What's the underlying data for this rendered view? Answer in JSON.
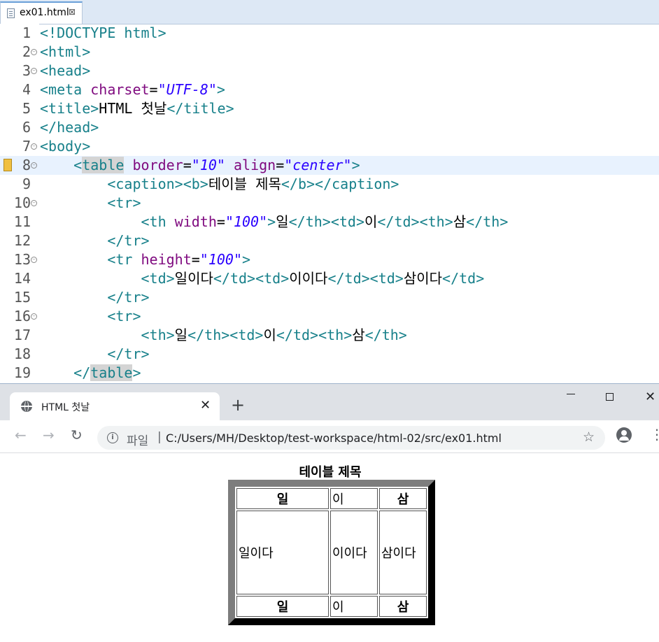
{
  "editor": {
    "tab_label": "ex01.html",
    "close_glyph": "⊠",
    "lines": [
      {
        "n": "1",
        "fold": false,
        "current": false,
        "tokens": [
          {
            "c": "t",
            "s": "<!DOCTYPE html>"
          }
        ]
      },
      {
        "n": "2",
        "fold": true,
        "current": false,
        "tokens": [
          {
            "c": "t",
            "s": "<html>"
          }
        ]
      },
      {
        "n": "3",
        "fold": true,
        "current": false,
        "tokens": [
          {
            "c": "t",
            "s": "<head>"
          }
        ]
      },
      {
        "n": "4",
        "fold": false,
        "current": false,
        "tokens": [
          {
            "c": "t",
            "s": "<meta "
          },
          {
            "c": "a",
            "s": "charset"
          },
          {
            "c": "x",
            "s": "="
          },
          {
            "c": "v",
            "s": "\"UTF-8\""
          },
          {
            "c": "t",
            "s": ">"
          }
        ]
      },
      {
        "n": "5",
        "fold": false,
        "current": false,
        "tokens": [
          {
            "c": "t",
            "s": "<title>"
          },
          {
            "c": "x",
            "s": "HTML 첫날"
          },
          {
            "c": "t",
            "s": "</title>"
          }
        ]
      },
      {
        "n": "6",
        "fold": false,
        "current": false,
        "tokens": [
          {
            "c": "t",
            "s": "</head>"
          }
        ]
      },
      {
        "n": "7",
        "fold": true,
        "current": false,
        "tokens": [
          {
            "c": "t",
            "s": "<body>"
          }
        ]
      },
      {
        "n": "8",
        "fold": true,
        "current": true,
        "marker": true,
        "tokens": [
          {
            "c": "x",
            "s": "    "
          },
          {
            "c": "t",
            "s": "<"
          },
          {
            "c": "t hl",
            "s": "table"
          },
          {
            "c": "t",
            "s": " "
          },
          {
            "c": "a",
            "s": "border"
          },
          {
            "c": "x",
            "s": "="
          },
          {
            "c": "v",
            "s": "\"10\""
          },
          {
            "c": "x",
            "s": " "
          },
          {
            "c": "a",
            "s": "align"
          },
          {
            "c": "x",
            "s": "="
          },
          {
            "c": "v",
            "s": "\"center\""
          },
          {
            "c": "t",
            "s": ">"
          }
        ]
      },
      {
        "n": "9",
        "fold": false,
        "current": false,
        "tokens": [
          {
            "c": "x",
            "s": "        "
          },
          {
            "c": "t",
            "s": "<caption><b>"
          },
          {
            "c": "x",
            "s": "테이블 제목"
          },
          {
            "c": "t",
            "s": "</b></caption>"
          }
        ]
      },
      {
        "n": "10",
        "fold": true,
        "current": false,
        "tokens": [
          {
            "c": "x",
            "s": "        "
          },
          {
            "c": "t",
            "s": "<tr>"
          }
        ]
      },
      {
        "n": "11",
        "fold": false,
        "current": false,
        "tokens": [
          {
            "c": "x",
            "s": "            "
          },
          {
            "c": "t",
            "s": "<th "
          },
          {
            "c": "a",
            "s": "width"
          },
          {
            "c": "x",
            "s": "="
          },
          {
            "c": "v",
            "s": "\"100\""
          },
          {
            "c": "t",
            "s": ">"
          },
          {
            "c": "x",
            "s": "일"
          },
          {
            "c": "t",
            "s": "</th><td>"
          },
          {
            "c": "x",
            "s": "이"
          },
          {
            "c": "t",
            "s": "</td><th>"
          },
          {
            "c": "x",
            "s": "삼"
          },
          {
            "c": "t",
            "s": "</th>"
          }
        ]
      },
      {
        "n": "12",
        "fold": false,
        "current": false,
        "tokens": [
          {
            "c": "x",
            "s": "        "
          },
          {
            "c": "t",
            "s": "</tr>"
          }
        ]
      },
      {
        "n": "13",
        "fold": true,
        "current": false,
        "tokens": [
          {
            "c": "x",
            "s": "        "
          },
          {
            "c": "t",
            "s": "<tr "
          },
          {
            "c": "a",
            "s": "height"
          },
          {
            "c": "x",
            "s": "="
          },
          {
            "c": "v",
            "s": "\"100\""
          },
          {
            "c": "t",
            "s": ">"
          }
        ]
      },
      {
        "n": "14",
        "fold": false,
        "current": false,
        "tokens": [
          {
            "c": "x",
            "s": "            "
          },
          {
            "c": "t",
            "s": "<td>"
          },
          {
            "c": "x",
            "s": "일이다"
          },
          {
            "c": "t",
            "s": "</td><td>"
          },
          {
            "c": "x",
            "s": "이이다"
          },
          {
            "c": "t",
            "s": "</td><td>"
          },
          {
            "c": "x",
            "s": "삼이다"
          },
          {
            "c": "t",
            "s": "</td>"
          }
        ]
      },
      {
        "n": "15",
        "fold": false,
        "current": false,
        "tokens": [
          {
            "c": "x",
            "s": "        "
          },
          {
            "c": "t",
            "s": "</tr>"
          }
        ]
      },
      {
        "n": "16",
        "fold": true,
        "current": false,
        "tokens": [
          {
            "c": "x",
            "s": "        "
          },
          {
            "c": "t",
            "s": "<tr>"
          }
        ]
      },
      {
        "n": "17",
        "fold": false,
        "current": false,
        "tokens": [
          {
            "c": "x",
            "s": "            "
          },
          {
            "c": "t",
            "s": "<th>"
          },
          {
            "c": "x",
            "s": "일"
          },
          {
            "c": "t",
            "s": "</th><td>"
          },
          {
            "c": "x",
            "s": "이"
          },
          {
            "c": "t",
            "s": "</td><th>"
          },
          {
            "c": "x",
            "s": "삼"
          },
          {
            "c": "t",
            "s": "</th>"
          }
        ]
      },
      {
        "n": "18",
        "fold": false,
        "current": false,
        "tokens": [
          {
            "c": "x",
            "s": "        "
          },
          {
            "c": "t",
            "s": "</tr>"
          }
        ]
      },
      {
        "n": "19",
        "fold": false,
        "current": false,
        "tokens": [
          {
            "c": "x",
            "s": "    "
          },
          {
            "c": "t",
            "s": "</"
          },
          {
            "c": "t hl",
            "s": "table"
          },
          {
            "c": "t",
            "s": ">"
          }
        ]
      }
    ]
  },
  "browser": {
    "tab_title": "HTML 첫날",
    "tab_close": "✕",
    "new_tab": "+",
    "window_close": "✕",
    "back": "←",
    "forward": "→",
    "reload": "↻",
    "info_glyph": "i",
    "scheme_label": "파일",
    "separator": "|",
    "url": "C:/Users/MH/Desktop/test-workspace/html-02/src/ex01.html",
    "star": "☆",
    "menu": "⋮",
    "icons": {
      "globe": "globe-icon",
      "info": "info-icon",
      "profile": "account-circle-icon"
    }
  },
  "page": {
    "caption": "테이블 제목",
    "rows": [
      {
        "cells": [
          {
            "tag": "th",
            "text": "일"
          },
          {
            "tag": "td",
            "text": "이"
          },
          {
            "tag": "th",
            "text": "삼"
          }
        ]
      },
      {
        "cells": [
          {
            "tag": "td",
            "text": "일이다"
          },
          {
            "tag": "td",
            "text": "이이다"
          },
          {
            "tag": "td",
            "text": "삼이다"
          }
        ]
      },
      {
        "cells": [
          {
            "tag": "th",
            "text": "일"
          },
          {
            "tag": "td",
            "text": "이"
          },
          {
            "tag": "th",
            "text": "삼"
          }
        ]
      }
    ]
  }
}
